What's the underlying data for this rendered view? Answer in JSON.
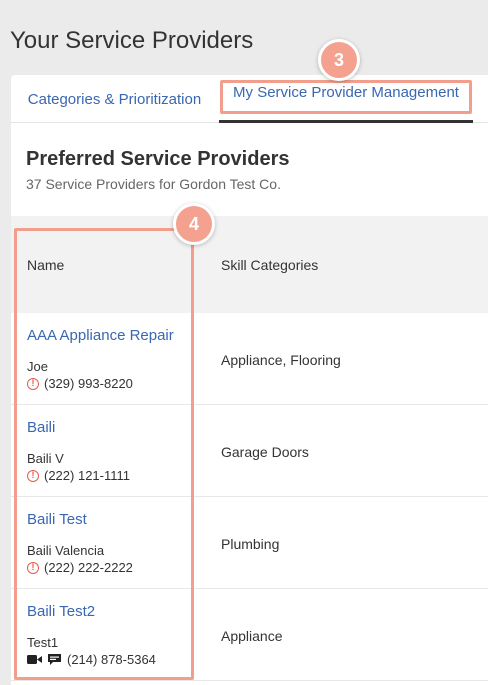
{
  "page": {
    "title": "Your Service Providers"
  },
  "tabs": [
    {
      "label": "Categories & Prioritization"
    },
    {
      "label": "My Service Provider Management"
    }
  ],
  "section": {
    "title": "Preferred Service Providers",
    "subtitle": "37 Service Providers for Gordon Test Co."
  },
  "table": {
    "columns": [
      "Name",
      "Skill Categories"
    ],
    "rows": [
      {
        "name": "AAA Appliance Repair",
        "contact": "Joe",
        "phone": "(329) 993-8220",
        "status_icon": "warning-icon",
        "skills": "Appliance, Flooring"
      },
      {
        "name": "Baili",
        "contact": "Baili V",
        "phone": "(222) 121-1111",
        "status_icon": "warning-icon",
        "skills": "Garage Doors"
      },
      {
        "name": "Baili Test",
        "contact": "Baili Valencia",
        "phone": "(222) 222-2222",
        "status_icon": "warning-icon",
        "skills": "Plumbing"
      },
      {
        "name": "Baili Test2",
        "contact": "Test1",
        "phone": "(214) 878-5364",
        "status_icon": "video-and-chat-icons",
        "skills": "Appliance"
      }
    ]
  },
  "annotations": [
    {
      "label": "3",
      "target": "My Service Provider Management tab"
    },
    {
      "label": "4",
      "target": "Name column"
    }
  ],
  "colors": {
    "link": "#3a67b1",
    "highlight": "#f29e8d",
    "badge": "#f5a18f",
    "warning": "#e35b4f"
  }
}
